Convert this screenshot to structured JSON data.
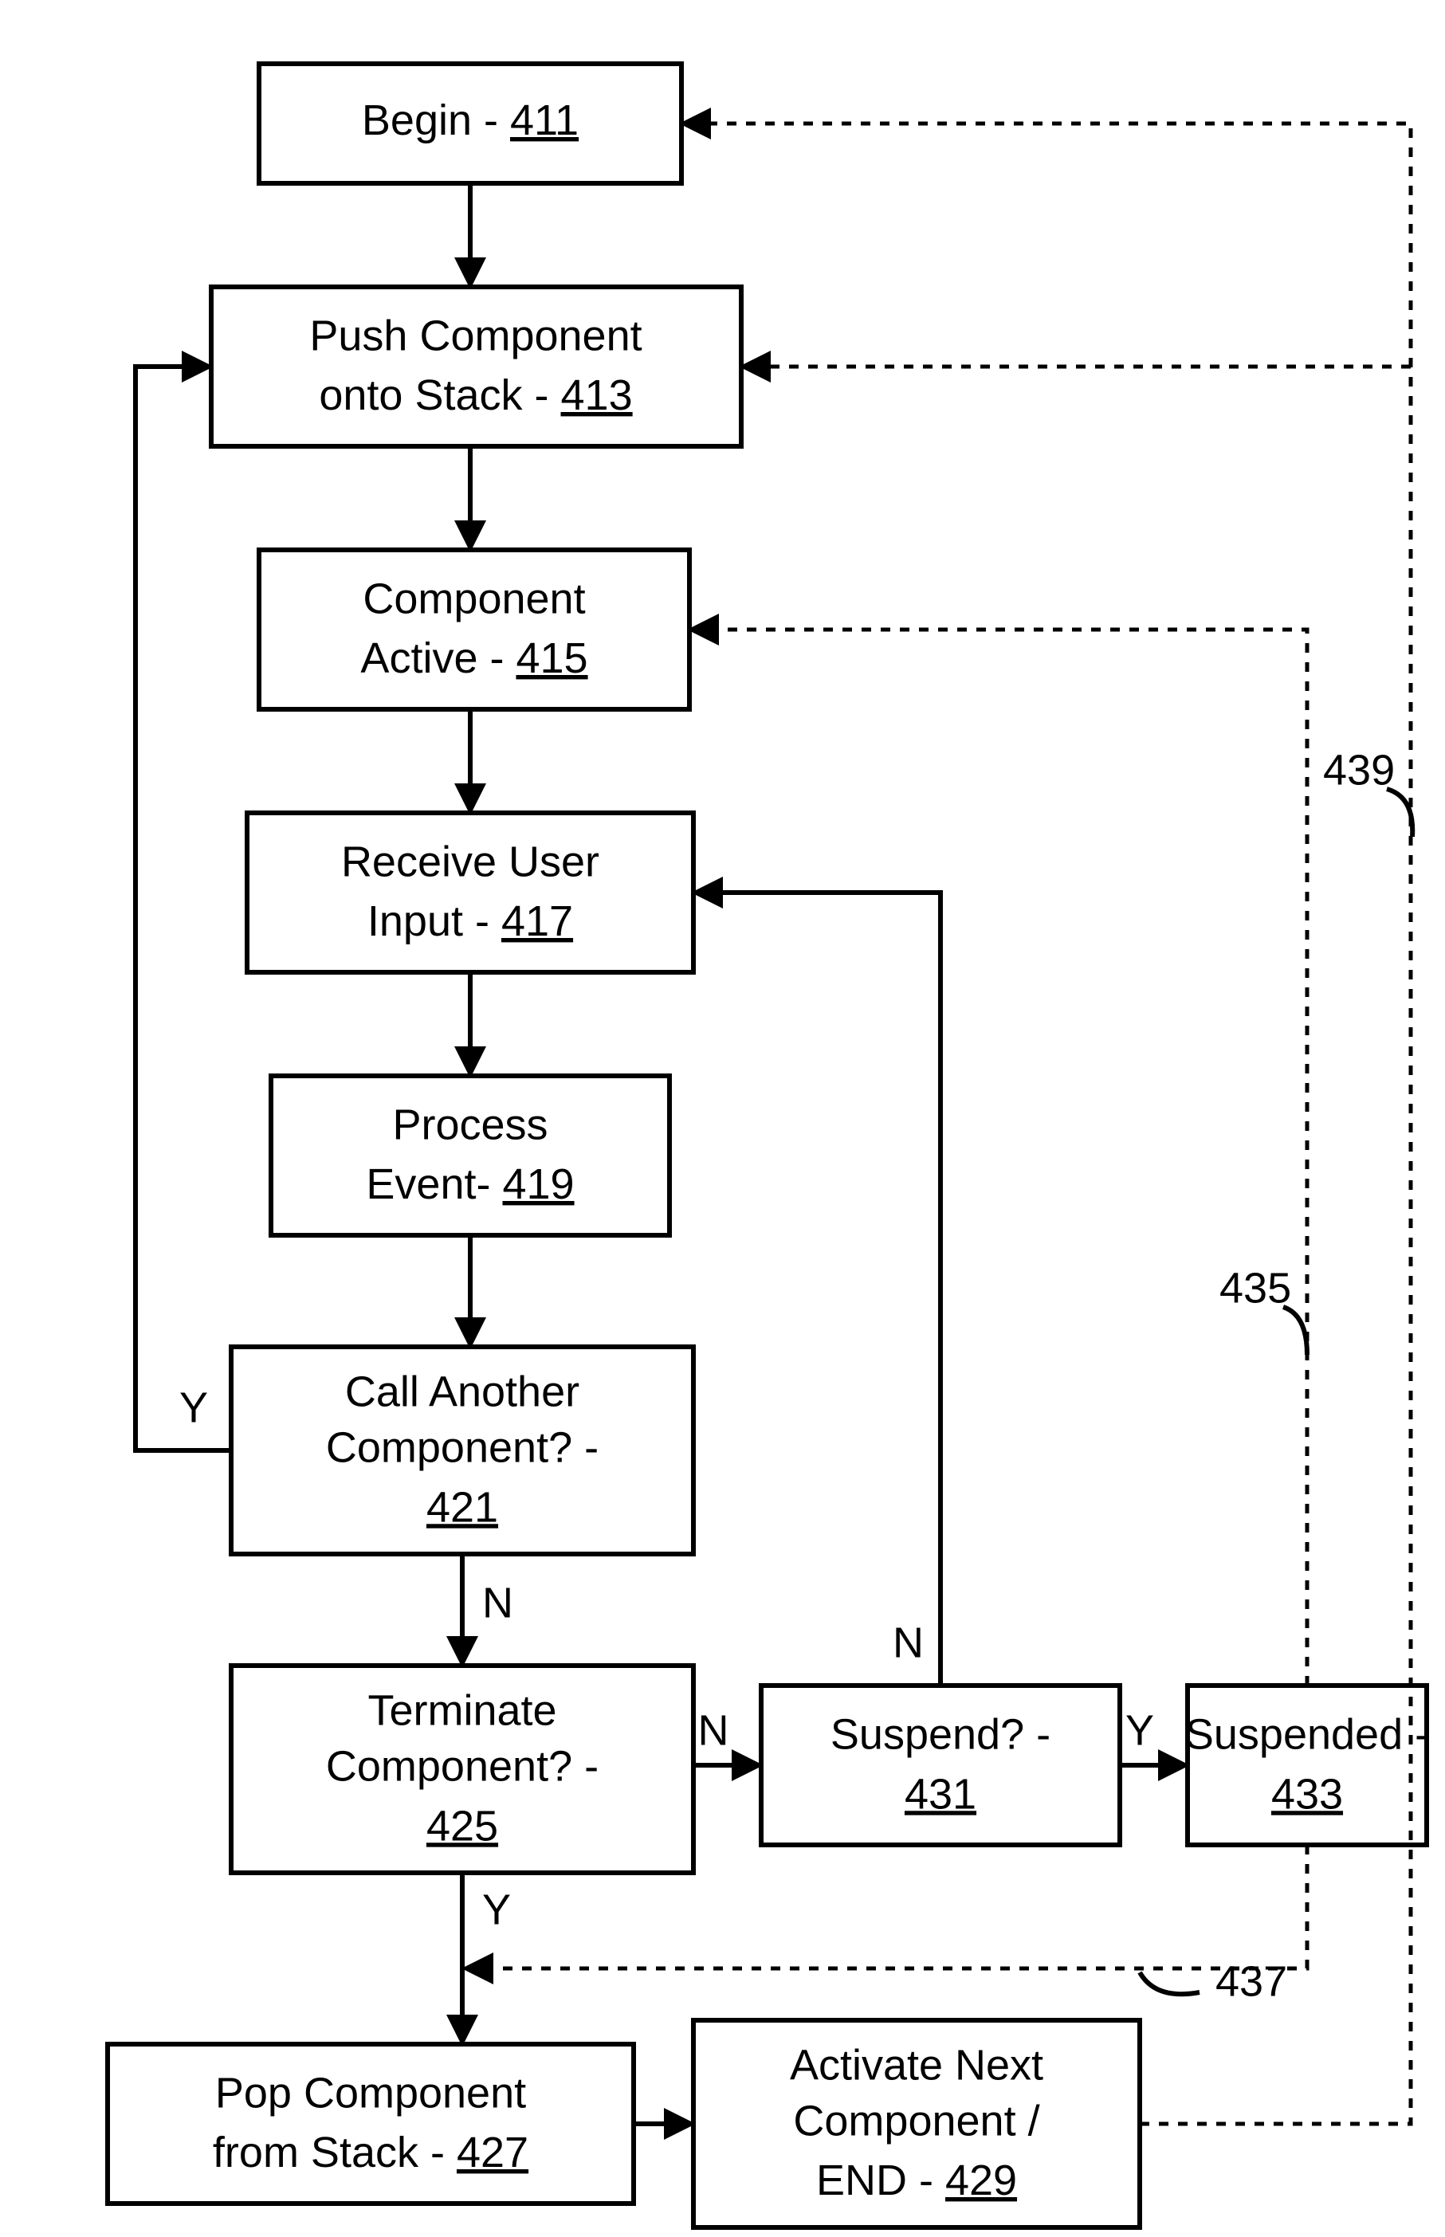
{
  "nodes": {
    "n411": {
      "line1": "Begin - ",
      "ref": "411"
    },
    "n413": {
      "line1": "Push Component",
      "line2": "onto Stack - ",
      "ref": "413"
    },
    "n415": {
      "line1": "Component",
      "line2": "Active - ",
      "ref": "415"
    },
    "n417": {
      "line1": "Receive User",
      "line2": "Input - ",
      "ref": "417"
    },
    "n419": {
      "line1": "Process",
      "line2": "Event- ",
      "ref": "419"
    },
    "n421": {
      "line1": "Call Another",
      "line2": "Component? -",
      "ref": "421"
    },
    "n425": {
      "line1": "Terminate",
      "line2": "Component? -",
      "ref": "425"
    },
    "n427": {
      "line1": "Pop Component",
      "line2": "from Stack - ",
      "ref": "427"
    },
    "n429": {
      "line1": "Activate Next",
      "line2": "Component /",
      "line3": "END - ",
      "ref": "429"
    },
    "n431": {
      "line1": "Suspend? -",
      "ref": "431"
    },
    "n433": {
      "line1": "Suspended -",
      "ref": "433"
    }
  },
  "labels": {
    "Y": "Y",
    "N": "N",
    "l435": "435",
    "l437": "437",
    "l439": "439"
  }
}
